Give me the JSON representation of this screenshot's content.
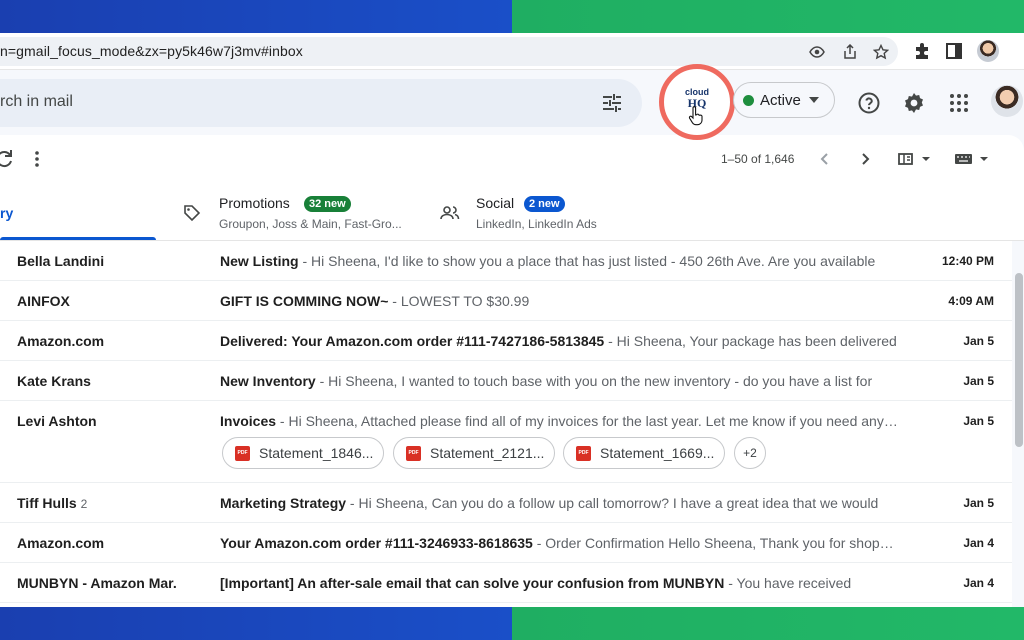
{
  "browser": {
    "url": "n=gmail_focus_mode&zx=py5k46w7j3mv#inbox",
    "icons": [
      "eye-icon",
      "share-icon",
      "star-icon",
      "extensions-icon",
      "side-panel-icon",
      "profile-avatar"
    ]
  },
  "header": {
    "search_placeholder": "rch in mail",
    "cloudhq_line1": "cloud",
    "cloudhq_line2": "HQ",
    "status_label": "Active",
    "status_color": "#1e8e3e",
    "highlight_color": "#ef6a5f",
    "icons": [
      "filter-icon",
      "help-icon",
      "settings-icon",
      "apps-grid-icon",
      "account-avatar"
    ]
  },
  "toolbar": {
    "page_count": "1–50 of 1,646",
    "icons": [
      "refresh-icon",
      "more-vert-icon",
      "prev-page-icon",
      "next-page-icon",
      "split-pane-icon",
      "keyboard-icon"
    ]
  },
  "tabs": {
    "primary": {
      "label": "ry",
      "color": "#0b57d0"
    },
    "promotions": {
      "label": "Promotions",
      "badge": "32 new",
      "badge_color": "#188038",
      "sub": "Groupon, Joss & Main, Fast-Gro..."
    },
    "social": {
      "label": "Social",
      "badge": "2 new",
      "badge_color": "#0b57d0",
      "sub": "LinkedIn, LinkedIn Ads"
    }
  },
  "emails": [
    {
      "sender": "Bella Landini",
      "count": "",
      "subject": "New Listing",
      "snippet": " - Hi Sheena, I'd like to show you a place that has just listed - 450 26th Ave. Are you available",
      "date": "12:40 PM"
    },
    {
      "sender": "AINFOX",
      "count": "",
      "subject": "GIFT IS COMMING NOW~",
      "snippet": " - LOWEST TO $30.99",
      "date": "4:09 AM"
    },
    {
      "sender": "Amazon.com",
      "count": "",
      "subject": "Delivered: Your Amazon.com order #111-7427186-5813845",
      "snippet": " - Hi Sheena, Your package has been delivered",
      "date": "Jan 5"
    },
    {
      "sender": "Kate Krans",
      "count": "",
      "subject": "New Inventory",
      "snippet": " - Hi Sheena, I wanted to touch base with you on the new inventory - do you have a list for",
      "date": "Jan 5"
    },
    {
      "sender": "Levi Ashton",
      "count": "",
      "subject": "Invoices",
      "snippet": " - Hi Sheena, Attached please find all of my invoices for the last year. Let me know if you need anything",
      "date": "Jan 5",
      "attachments": [
        "Statement_1846...",
        "Statement_2121...",
        "Statement_1669..."
      ],
      "more_attachments": "+2"
    },
    {
      "sender": "Tiff Hulls",
      "count": "2",
      "subject": "Marketing Strategy",
      "snippet": " - Hi Sheena, Can you do a follow up call tomorrow? I have a great idea that we would",
      "date": "Jan 5"
    },
    {
      "sender": "Amazon.com",
      "count": "",
      "subject": "Your Amazon.com order #111-3246933-8618635",
      "snippet": " - Order Confirmation Hello Sheena, Thank you for shopping",
      "date": "Jan 4"
    },
    {
      "sender": "MUNBYN - Amazon Mar.",
      "count": "",
      "subject": "[Important] An after-sale email that can solve your confusion from MUNBYN",
      "snippet": " - You have received",
      "date": "Jan 4"
    }
  ]
}
